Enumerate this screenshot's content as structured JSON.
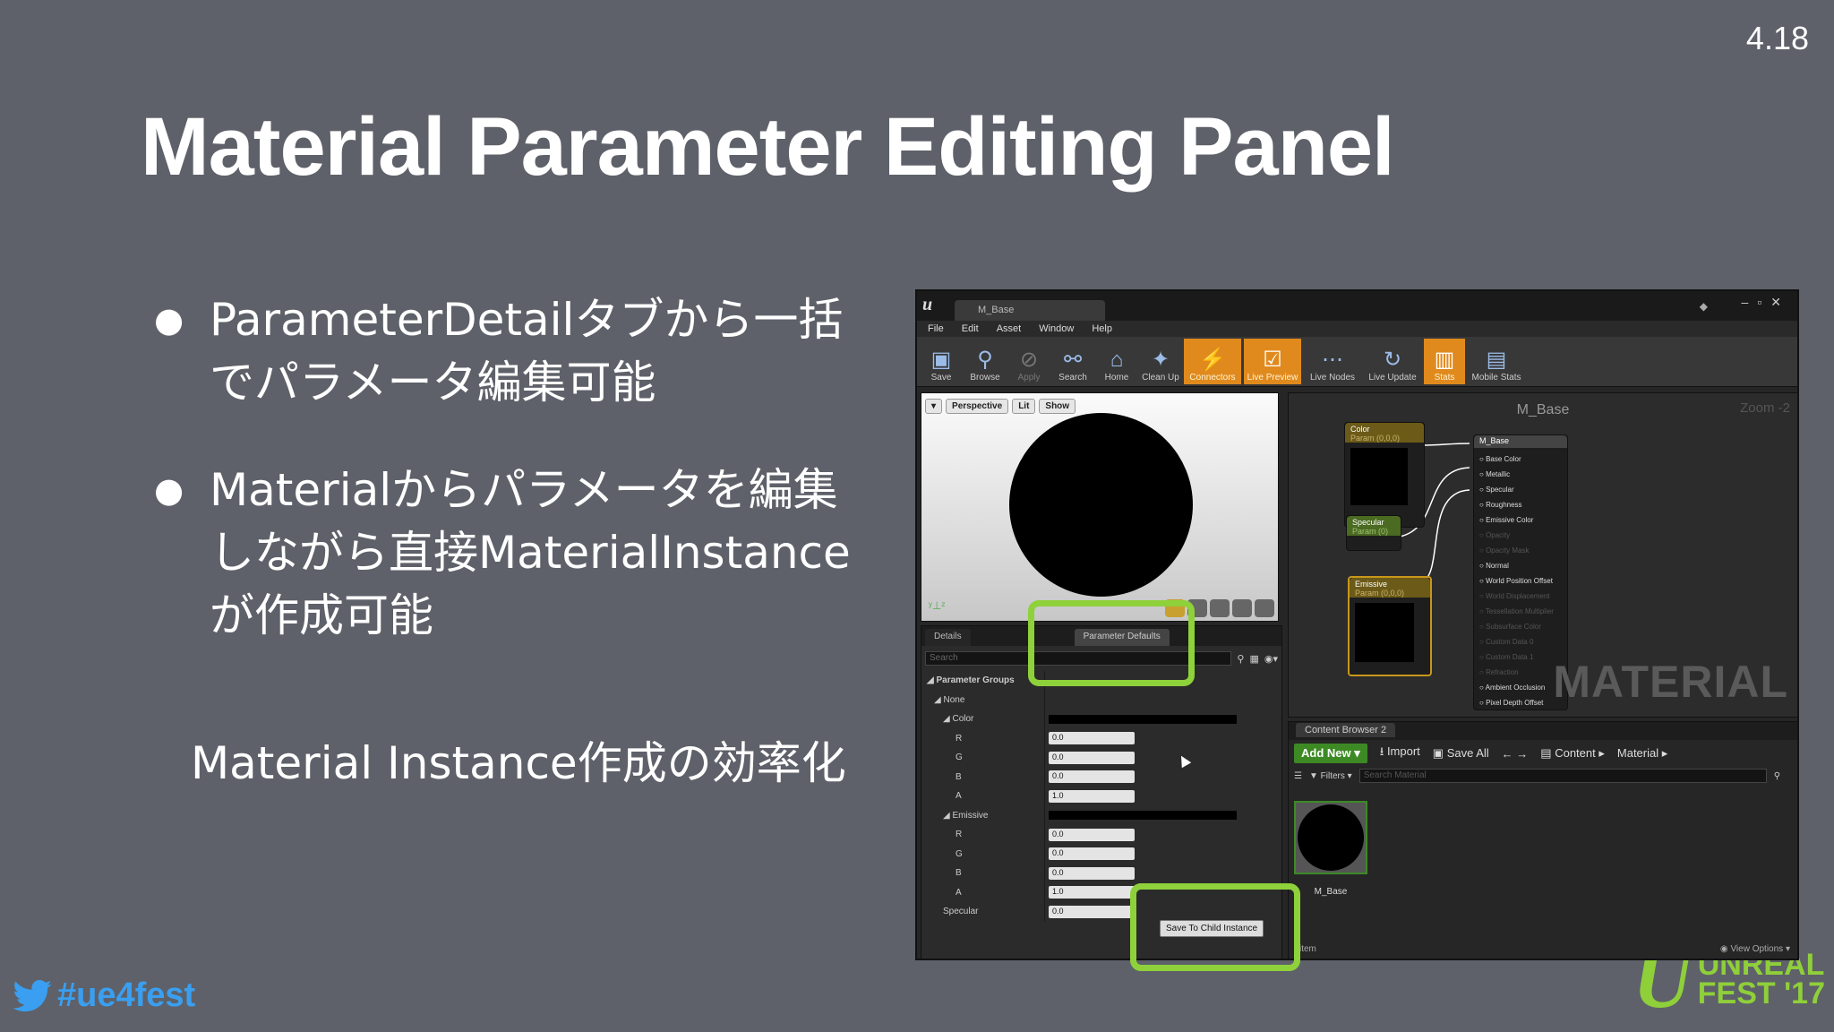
{
  "slide": {
    "version": "4.18",
    "title": "Material Parameter Editing Panel",
    "bullets": [
      "ParameterDetailタブから一括\nでパラメータ編集可能",
      "Materialからパラメータを編集\nしながら直接MaterialInstance\nが作成可能"
    ],
    "summary": "Material Instance作成の効率化",
    "hashtag": "#ue4fest",
    "logo": {
      "line1": "UNREAL",
      "line2": "FEST '17"
    },
    "colors": {
      "background": "#5e6169",
      "highlight": "#8ed13b",
      "twitter": "#3a9ff0"
    }
  },
  "editor": {
    "tab_title": "M_Base",
    "menu": [
      "File",
      "Edit",
      "Asset",
      "Window",
      "Help"
    ],
    "toolbar": [
      {
        "label": "Save",
        "icon": "save-icon",
        "glyph": "▣",
        "state": "normal"
      },
      {
        "label": "Browse",
        "icon": "browse-icon",
        "glyph": "⚲",
        "state": "normal"
      },
      {
        "label": "Apply",
        "icon": "apply-icon",
        "glyph": "⊘",
        "state": "disabled"
      },
      {
        "label": "Search",
        "icon": "search-icon",
        "glyph": "⚯",
        "state": "normal"
      },
      {
        "label": "Home",
        "icon": "home-icon",
        "glyph": "⌂",
        "state": "normal"
      },
      {
        "label": "Clean Up",
        "icon": "clean-up-icon",
        "glyph": "✦",
        "state": "normal"
      },
      {
        "label": "Connectors",
        "icon": "connectors-icon",
        "glyph": "⚡",
        "state": "active"
      },
      {
        "label": "Live Preview",
        "icon": "live-preview-icon",
        "glyph": "☑",
        "state": "active"
      },
      {
        "label": "Live Nodes",
        "icon": "live-nodes-icon",
        "glyph": "⋯",
        "state": "normal"
      },
      {
        "label": "Live Update",
        "icon": "live-update-icon",
        "glyph": "↻",
        "state": "normal"
      },
      {
        "label": "Stats",
        "icon": "stats-icon",
        "glyph": "▥",
        "state": "active"
      },
      {
        "label": "Mobile Stats",
        "icon": "mobile-stats-icon",
        "glyph": "▤",
        "state": "normal"
      }
    ],
    "viewport": {
      "perspective": "Perspective",
      "lit": "Lit",
      "show": "Show"
    },
    "graph": {
      "title": "M_Base",
      "zoom": "Zoom -2",
      "watermark": "MATERIAL",
      "nodes": {
        "color": {
          "title": "Color",
          "sub": "Param (0,0,0)"
        },
        "specular": {
          "title": "Specular",
          "sub": "Param (0)"
        },
        "emissive": {
          "title": "Emissive",
          "sub": "Param (0,0,0)"
        }
      },
      "base_node": {
        "title": "M_Base",
        "pins": [
          {
            "label": "Base Color",
            "on": true
          },
          {
            "label": "Metallic",
            "on": true
          },
          {
            "label": "Specular",
            "on": true
          },
          {
            "label": "Roughness",
            "on": true
          },
          {
            "label": "Emissive Color",
            "on": true
          },
          {
            "label": "Opacity",
            "on": false
          },
          {
            "label": "Opacity Mask",
            "on": false
          },
          {
            "label": "Normal",
            "on": true
          },
          {
            "label": "World Position Offset",
            "on": true
          },
          {
            "label": "World Displacement",
            "on": false
          },
          {
            "label": "Tessellation Multiplier",
            "on": false
          },
          {
            "label": "Subsurface Color",
            "on": false
          },
          {
            "label": "Custom Data 0",
            "on": false
          },
          {
            "label": "Custom Data 1",
            "on": false
          },
          {
            "label": "Refraction",
            "on": false
          },
          {
            "label": "Ambient Occlusion",
            "on": true
          },
          {
            "label": "Pixel Depth Offset",
            "on": true
          }
        ]
      }
    },
    "details": {
      "tab1": "Details",
      "tab2": "Parameter Defaults",
      "search_placeholder": "Search",
      "rows": [
        {
          "label": "Parameter Groups",
          "indent": 0,
          "bold": true
        },
        {
          "label": "None",
          "indent": 1
        },
        {
          "label": "Color",
          "indent": 2,
          "colorbar": true
        },
        {
          "label": "R",
          "indent": 3,
          "value": "0.0"
        },
        {
          "label": "G",
          "indent": 3,
          "value": "0.0"
        },
        {
          "label": "B",
          "indent": 3,
          "value": "0.0"
        },
        {
          "label": "A",
          "indent": 3,
          "value": "1.0"
        },
        {
          "label": "Emissive",
          "indent": 2,
          "colorbar": true
        },
        {
          "label": "R",
          "indent": 3,
          "value": "0.0"
        },
        {
          "label": "G",
          "indent": 3,
          "value": "0.0"
        },
        {
          "label": "B",
          "indent": 3,
          "value": "0.0"
        },
        {
          "label": "A",
          "indent": 3,
          "value": "1.0"
        },
        {
          "label": "Specular",
          "indent": 2,
          "value": "0.0"
        }
      ],
      "save_child": "Save To Child Instance"
    },
    "content_browser": {
      "tab": "Content Browser 2",
      "add_new": "Add New",
      "import": "Import",
      "save_all": "Save All",
      "path": [
        "Content",
        "Material"
      ],
      "filters": "Filters",
      "search_placeholder": "Search Material",
      "asset": "M_Base",
      "footer_left": "item",
      "view_options": "View Options"
    }
  }
}
